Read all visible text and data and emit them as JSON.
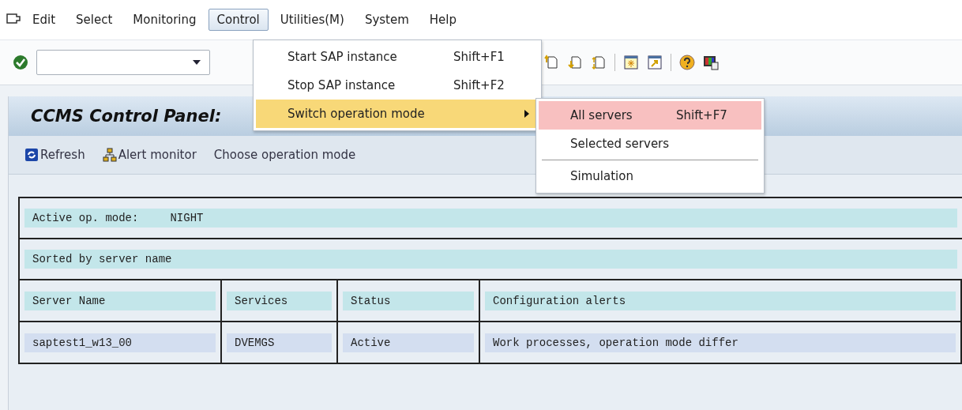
{
  "menubar": {
    "items": [
      {
        "label": "Edit",
        "selected": false
      },
      {
        "label": "Select",
        "selected": false
      },
      {
        "label": "Monitoring",
        "selected": false
      },
      {
        "label": "Control",
        "selected": true
      },
      {
        "label": "Utilities(M)",
        "selected": false
      },
      {
        "label": "System",
        "selected": false
      },
      {
        "label": "Help",
        "selected": false
      }
    ]
  },
  "control_menu": {
    "items": [
      {
        "label": "Start SAP instance",
        "shortcut": "Shift+F1",
        "selected": false,
        "kind": "item"
      },
      {
        "label": "Stop SAP instance",
        "shortcut": "Shift+F2",
        "selected": false,
        "kind": "item"
      },
      {
        "label": "Switch operation mode",
        "selected": true,
        "kind": "submenu"
      }
    ]
  },
  "submenu": {
    "items": [
      {
        "label": "All servers",
        "shortcut": "Shift+F7",
        "selected": true,
        "separator_before": false
      },
      {
        "label": "Selected servers",
        "selected": false,
        "separator_before": false
      },
      {
        "label": "Simulation",
        "selected": false,
        "separator_before": true
      }
    ]
  },
  "title": "CCMS Control Panel:",
  "app_toolbar": [
    {
      "label": "Refresh",
      "kind": "refresh"
    },
    {
      "label": "Alert monitor",
      "kind": "hierarchy"
    },
    {
      "label": "Choose operation mode",
      "kind": "text"
    }
  ],
  "info": {
    "active_label": "Active op. mode:",
    "active_value": "NIGHT",
    "sort_note": "Sorted by server name"
  },
  "table": {
    "columns": [
      "Server Name",
      "Services",
      "Status",
      "Configuration alerts"
    ],
    "rows": [
      [
        "saptest1_w13_00",
        "DVEMGS",
        "Active",
        "Work processes, operation mode differ"
      ]
    ]
  }
}
